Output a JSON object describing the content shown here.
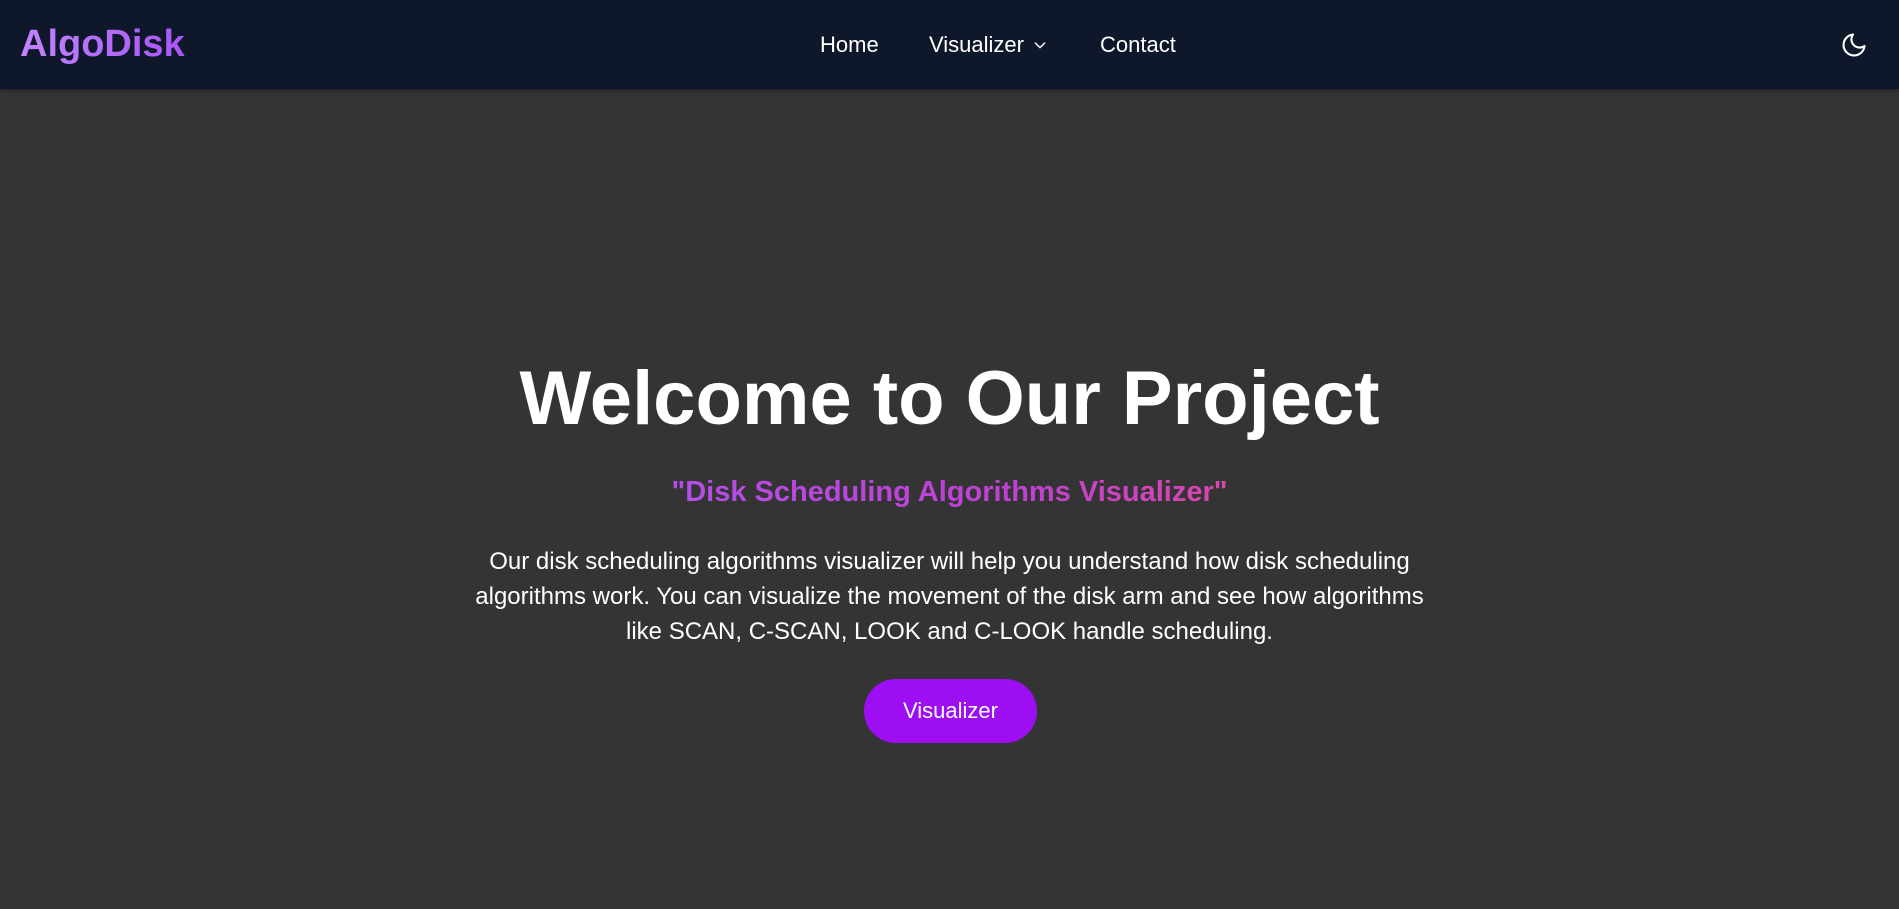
{
  "navbar": {
    "brand": "AlgoDisk",
    "links": [
      {
        "label": "Home"
      },
      {
        "label": "Visualizer",
        "icon": "chevron-down-icon"
      },
      {
        "label": "Contact"
      }
    ],
    "theme_toggle_icon": "moon-icon"
  },
  "hero": {
    "title": "Welcome to Our Project",
    "subtitle": "\"Disk Scheduling Algorithms Visualizer\"",
    "description": "Our disk scheduling algorithms visualizer will help you understand how disk scheduling algorithms work. You can visualize the movement of the disk arm and see how algorithms like SCAN, C-SCAN, LOOK and C-LOOK handle scheduling.",
    "button_label": "Visualizer"
  },
  "colors": {
    "navbar_bg": "#0f172a",
    "page_bg": "#343434",
    "accent": "#9d0ff2",
    "brand_gradient": [
      "#c084fc",
      "#a855f7"
    ],
    "subtitle_gradient": [
      "#b44ee8",
      "#d946ae"
    ]
  }
}
